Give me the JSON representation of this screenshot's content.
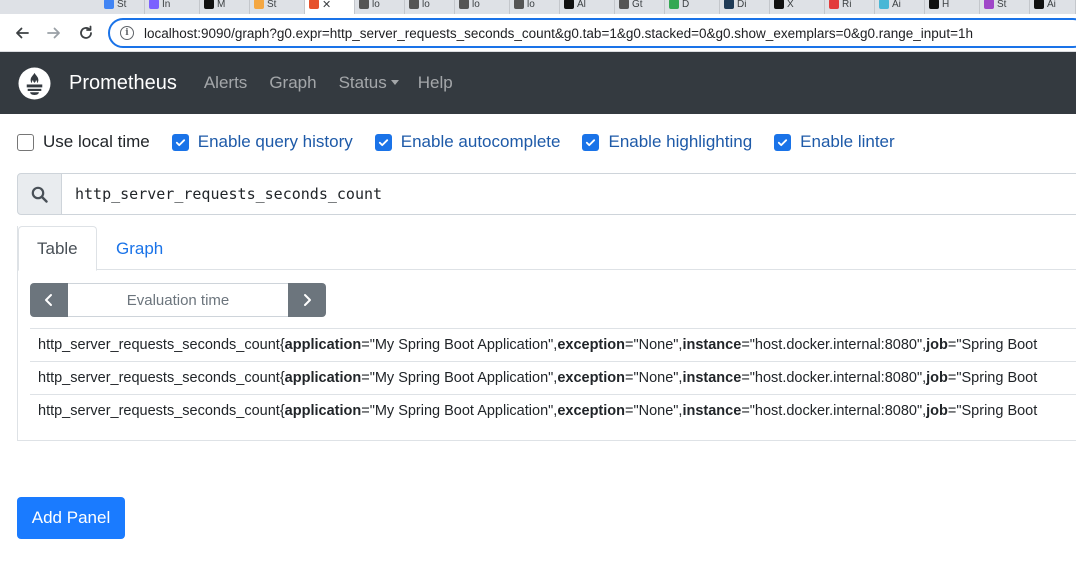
{
  "browser": {
    "tabs": [
      {
        "label": "St",
        "color": "#4285f4"
      },
      {
        "label": "In",
        "color": "#7b61ff"
      },
      {
        "label": "M",
        "color": "#111111"
      },
      {
        "label": "St",
        "color": "#f4a742"
      },
      {
        "label": "",
        "color": "#e6522c",
        "active": true
      },
      {
        "label": "lo",
        "color": "#555555"
      },
      {
        "label": "lo",
        "color": "#555555"
      },
      {
        "label": "lo",
        "color": "#555555"
      },
      {
        "label": "lo",
        "color": "#555555"
      },
      {
        "label": "Al",
        "color": "#111111"
      },
      {
        "label": "Gt",
        "color": "#555555"
      },
      {
        "label": "D",
        "color": "#34a853"
      },
      {
        "label": "Di",
        "color": "#1f3b57"
      },
      {
        "label": "X",
        "color": "#111111"
      },
      {
        "label": "Ri",
        "color": "#e33b3b"
      },
      {
        "label": "Ai",
        "color": "#49b7d6"
      },
      {
        "label": "H",
        "color": "#111111"
      },
      {
        "label": "St",
        "color": "#a046c8"
      },
      {
        "label": "Ai",
        "color": "#111111"
      }
    ],
    "url": "localhost:9090/graph?g0.expr=http_server_requests_seconds_count&g0.tab=1&g0.stacked=0&g0.show_exemplars=0&g0.range_input=1h"
  },
  "navbar": {
    "brand": "Prometheus",
    "links": {
      "alerts": "Alerts",
      "graph": "Graph",
      "status": "Status",
      "help": "Help"
    }
  },
  "options": {
    "use_local_time": {
      "label": "Use local time",
      "checked": false
    },
    "query_history": {
      "label": "Enable query history",
      "checked": true
    },
    "autocomplete": {
      "label": "Enable autocomplete",
      "checked": true
    },
    "highlighting": {
      "label": "Enable highlighting",
      "checked": true
    },
    "linter": {
      "label": "Enable linter",
      "checked": true
    }
  },
  "query": {
    "expression": "http_server_requests_seconds_count"
  },
  "panel": {
    "tabs": {
      "table": "Table",
      "graph": "Graph"
    },
    "eval_time_placeholder": "Evaluation time",
    "results": [
      {
        "metric": "http_server_requests_seconds_count{",
        "labels": [
          {
            "k": "application",
            "v": "\"My Spring Boot Application\", "
          },
          {
            "k": "exception",
            "v": "\"None\", "
          },
          {
            "k": "instance",
            "v": "\"host.docker.internal:8080\", "
          },
          {
            "k": "job",
            "v": "\"Spring Boot"
          }
        ]
      },
      {
        "metric": "http_server_requests_seconds_count{",
        "labels": [
          {
            "k": "application",
            "v": "\"My Spring Boot Application\", "
          },
          {
            "k": "exception",
            "v": "\"None\", "
          },
          {
            "k": "instance",
            "v": "\"host.docker.internal:8080\", "
          },
          {
            "k": "job",
            "v": "\"Spring Boot"
          }
        ]
      },
      {
        "metric": "http_server_requests_seconds_count{",
        "labels": [
          {
            "k": "application",
            "v": "\"My Spring Boot Application\", "
          },
          {
            "k": "exception",
            "v": "\"None\", "
          },
          {
            "k": "instance",
            "v": "\"host.docker.internal:8080\", "
          },
          {
            "k": "job",
            "v": "\"Spring Boot"
          }
        ]
      }
    ]
  },
  "add_panel_label": "Add Panel",
  "colors": {
    "navbar": "#343a40",
    "primary": "#1a7bff",
    "checkbox": "#1a73e8",
    "eval_button": "#6c757d"
  }
}
